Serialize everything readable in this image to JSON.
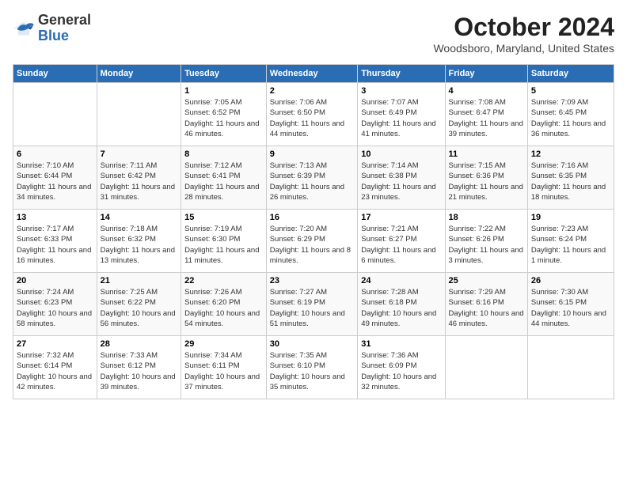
{
  "logo": {
    "general": "General",
    "blue": "Blue"
  },
  "title": "October 2024",
  "location": "Woodsboro, Maryland, United States",
  "days_of_week": [
    "Sunday",
    "Monday",
    "Tuesday",
    "Wednesday",
    "Thursday",
    "Friday",
    "Saturday"
  ],
  "weeks": [
    [
      {
        "num": "",
        "info": ""
      },
      {
        "num": "",
        "info": ""
      },
      {
        "num": "1",
        "info": "Sunrise: 7:05 AM\nSunset: 6:52 PM\nDaylight: 11 hours and 46 minutes."
      },
      {
        "num": "2",
        "info": "Sunrise: 7:06 AM\nSunset: 6:50 PM\nDaylight: 11 hours and 44 minutes."
      },
      {
        "num": "3",
        "info": "Sunrise: 7:07 AM\nSunset: 6:49 PM\nDaylight: 11 hours and 41 minutes."
      },
      {
        "num": "4",
        "info": "Sunrise: 7:08 AM\nSunset: 6:47 PM\nDaylight: 11 hours and 39 minutes."
      },
      {
        "num": "5",
        "info": "Sunrise: 7:09 AM\nSunset: 6:45 PM\nDaylight: 11 hours and 36 minutes."
      }
    ],
    [
      {
        "num": "6",
        "info": "Sunrise: 7:10 AM\nSunset: 6:44 PM\nDaylight: 11 hours and 34 minutes."
      },
      {
        "num": "7",
        "info": "Sunrise: 7:11 AM\nSunset: 6:42 PM\nDaylight: 11 hours and 31 minutes."
      },
      {
        "num": "8",
        "info": "Sunrise: 7:12 AM\nSunset: 6:41 PM\nDaylight: 11 hours and 28 minutes."
      },
      {
        "num": "9",
        "info": "Sunrise: 7:13 AM\nSunset: 6:39 PM\nDaylight: 11 hours and 26 minutes."
      },
      {
        "num": "10",
        "info": "Sunrise: 7:14 AM\nSunset: 6:38 PM\nDaylight: 11 hours and 23 minutes."
      },
      {
        "num": "11",
        "info": "Sunrise: 7:15 AM\nSunset: 6:36 PM\nDaylight: 11 hours and 21 minutes."
      },
      {
        "num": "12",
        "info": "Sunrise: 7:16 AM\nSunset: 6:35 PM\nDaylight: 11 hours and 18 minutes."
      }
    ],
    [
      {
        "num": "13",
        "info": "Sunrise: 7:17 AM\nSunset: 6:33 PM\nDaylight: 11 hours and 16 minutes."
      },
      {
        "num": "14",
        "info": "Sunrise: 7:18 AM\nSunset: 6:32 PM\nDaylight: 11 hours and 13 minutes."
      },
      {
        "num": "15",
        "info": "Sunrise: 7:19 AM\nSunset: 6:30 PM\nDaylight: 11 hours and 11 minutes."
      },
      {
        "num": "16",
        "info": "Sunrise: 7:20 AM\nSunset: 6:29 PM\nDaylight: 11 hours and 8 minutes."
      },
      {
        "num": "17",
        "info": "Sunrise: 7:21 AM\nSunset: 6:27 PM\nDaylight: 11 hours and 6 minutes."
      },
      {
        "num": "18",
        "info": "Sunrise: 7:22 AM\nSunset: 6:26 PM\nDaylight: 11 hours and 3 minutes."
      },
      {
        "num": "19",
        "info": "Sunrise: 7:23 AM\nSunset: 6:24 PM\nDaylight: 11 hours and 1 minute."
      }
    ],
    [
      {
        "num": "20",
        "info": "Sunrise: 7:24 AM\nSunset: 6:23 PM\nDaylight: 10 hours and 58 minutes."
      },
      {
        "num": "21",
        "info": "Sunrise: 7:25 AM\nSunset: 6:22 PM\nDaylight: 10 hours and 56 minutes."
      },
      {
        "num": "22",
        "info": "Sunrise: 7:26 AM\nSunset: 6:20 PM\nDaylight: 10 hours and 54 minutes."
      },
      {
        "num": "23",
        "info": "Sunrise: 7:27 AM\nSunset: 6:19 PM\nDaylight: 10 hours and 51 minutes."
      },
      {
        "num": "24",
        "info": "Sunrise: 7:28 AM\nSunset: 6:18 PM\nDaylight: 10 hours and 49 minutes."
      },
      {
        "num": "25",
        "info": "Sunrise: 7:29 AM\nSunset: 6:16 PM\nDaylight: 10 hours and 46 minutes."
      },
      {
        "num": "26",
        "info": "Sunrise: 7:30 AM\nSunset: 6:15 PM\nDaylight: 10 hours and 44 minutes."
      }
    ],
    [
      {
        "num": "27",
        "info": "Sunrise: 7:32 AM\nSunset: 6:14 PM\nDaylight: 10 hours and 42 minutes."
      },
      {
        "num": "28",
        "info": "Sunrise: 7:33 AM\nSunset: 6:12 PM\nDaylight: 10 hours and 39 minutes."
      },
      {
        "num": "29",
        "info": "Sunrise: 7:34 AM\nSunset: 6:11 PM\nDaylight: 10 hours and 37 minutes."
      },
      {
        "num": "30",
        "info": "Sunrise: 7:35 AM\nSunset: 6:10 PM\nDaylight: 10 hours and 35 minutes."
      },
      {
        "num": "31",
        "info": "Sunrise: 7:36 AM\nSunset: 6:09 PM\nDaylight: 10 hours and 32 minutes."
      },
      {
        "num": "",
        "info": ""
      },
      {
        "num": "",
        "info": ""
      }
    ]
  ]
}
